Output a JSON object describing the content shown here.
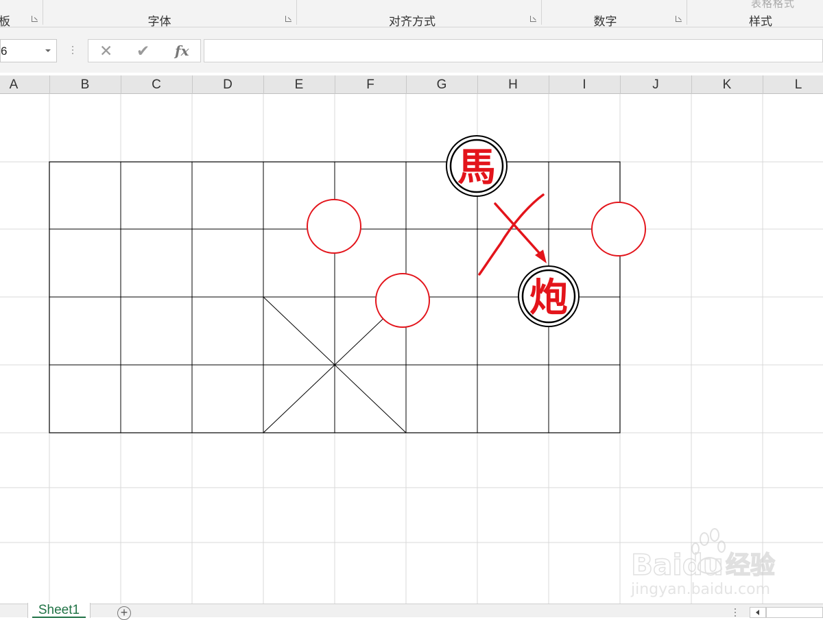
{
  "ribbon": {
    "groups": [
      {
        "label": "板"
      },
      {
        "label": "字体"
      },
      {
        "label": "对齐方式"
      },
      {
        "label": "数字"
      },
      {
        "label": "样式"
      }
    ],
    "cut_text": "表格格式"
  },
  "formula_bar": {
    "name_box_value": "6",
    "cancel_glyph": "✕",
    "enter_glyph": "✔",
    "fx_label": "fx",
    "formula_value": ""
  },
  "columns": [
    "A",
    "B",
    "C",
    "D",
    "E",
    "F",
    "G",
    "H",
    "I",
    "J",
    "K",
    "L"
  ],
  "board": {
    "pieces": [
      {
        "char": "馬",
        "color": "#e3141b"
      },
      {
        "char": "炮",
        "color": "#e3141b"
      }
    ],
    "marker_color": "#e3141b",
    "arrow_color": "#e3141b"
  },
  "sheet_tabs": {
    "active": "Sheet1",
    "add_glyph": "+"
  },
  "watermark": {
    "logo": "Baidu",
    "brand": "经验",
    "url": "jingyan.baidu.com"
  }
}
